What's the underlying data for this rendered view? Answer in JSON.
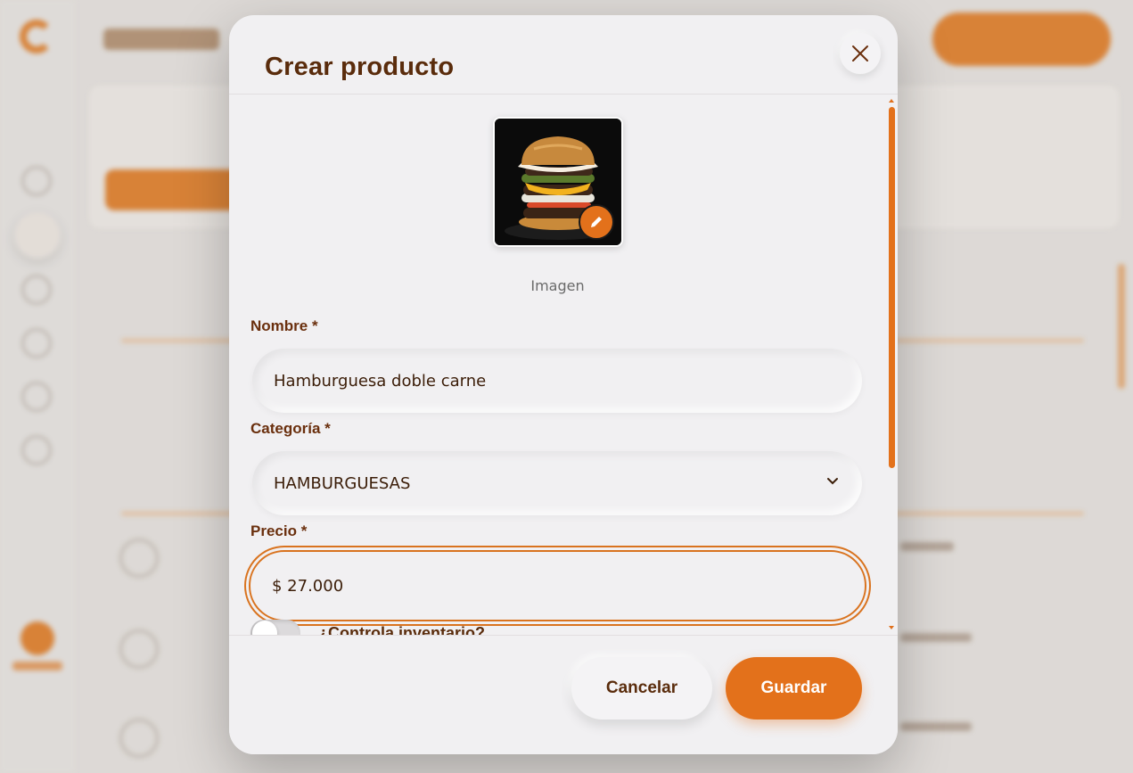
{
  "modal": {
    "title": "Crear producto",
    "image_caption": "Imagen",
    "fields": {
      "name": {
        "label": "Nombre *",
        "value": "Hamburguesa doble carne"
      },
      "category": {
        "label": "Categoría *",
        "value": "HAMBURGUESAS"
      },
      "price": {
        "label": "Precio *",
        "value": "$ 27.000"
      }
    },
    "inventory_toggle": {
      "label": "¿Controla inventario?",
      "checked": false
    },
    "buttons": {
      "cancel": "Cancelar",
      "save": "Guardar"
    }
  },
  "colors": {
    "accent": "#e3711b",
    "title": "#5a2c0c",
    "surface": "#f1f0f2"
  },
  "icons": {
    "close": "close-icon",
    "edit": "pencil-icon",
    "dropdown": "chevron-down-icon"
  }
}
